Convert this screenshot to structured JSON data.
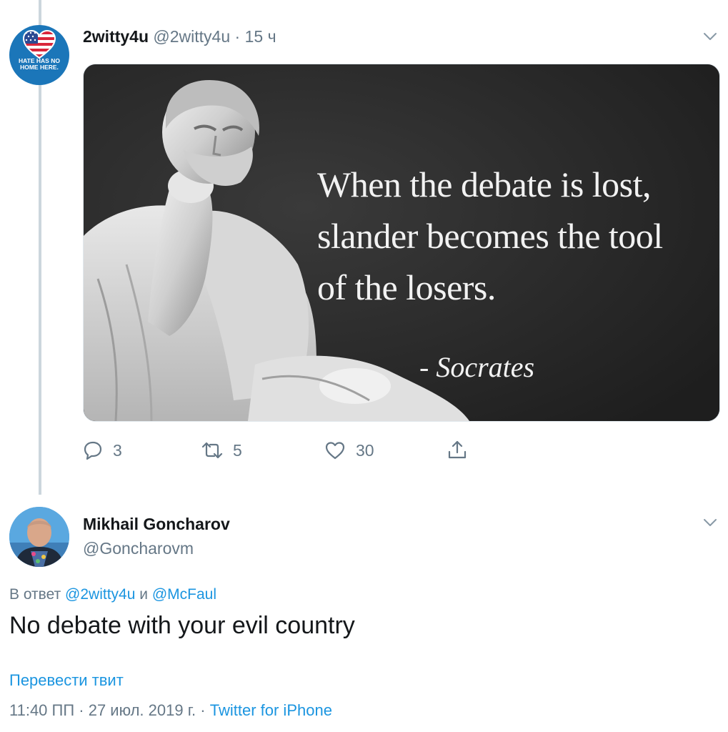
{
  "tweet1": {
    "display_name": "2witty4u",
    "handle": "@2witty4u",
    "separator": "·",
    "time": "15 ч",
    "avatar_text_line1": "HATE HAS NO",
    "avatar_text_line2": "HOME HERE.",
    "image": {
      "quote_lines": [
        "When the debate is lost,",
        "slander becomes the tool",
        "of the losers."
      ],
      "attribution": "- Socrates"
    },
    "actions": {
      "replies": "3",
      "retweets": "5",
      "likes": "30"
    }
  },
  "tweet2": {
    "display_name": "Mikhail Goncharov",
    "handle": "@Goncharovm",
    "reply_prefix": "В ответ",
    "reply_mention1": "@2witty4u",
    "reply_and": "и",
    "reply_mention2": "@McFaul",
    "text": "No debate with your evil country",
    "translate_label": "Перевести твит",
    "timestamp": "11:40 ПП · 27 июл. 2019 г.",
    "meta_separator": "·",
    "source": "Twitter for iPhone"
  },
  "colors": {
    "link": "#1b95e0",
    "secondary_text": "#657786",
    "thread_line": "#ccd6dd"
  }
}
